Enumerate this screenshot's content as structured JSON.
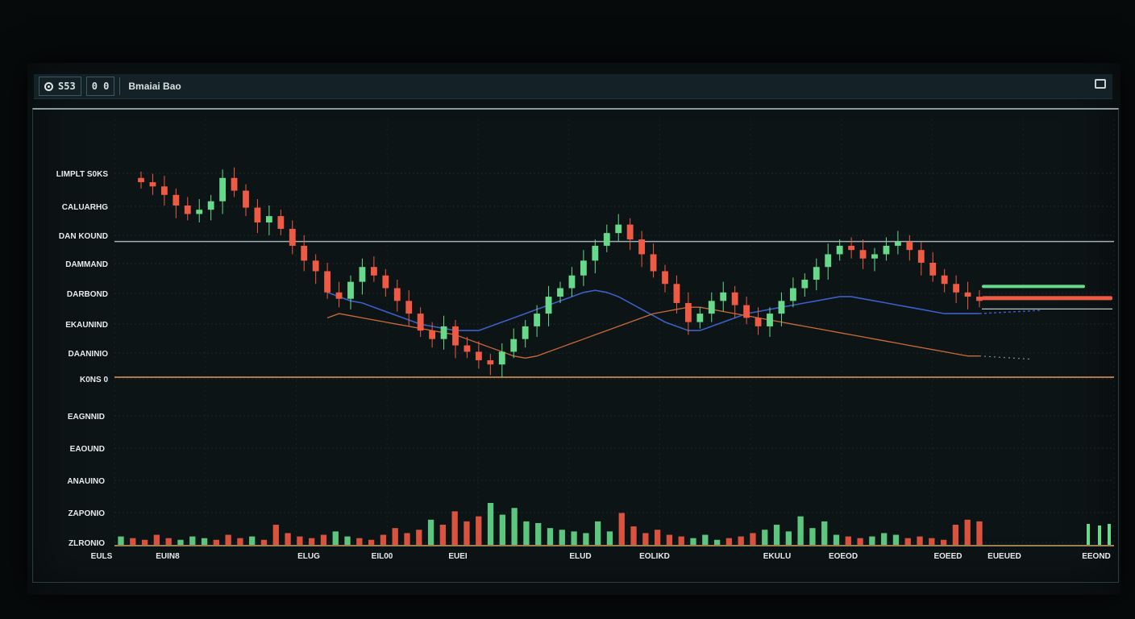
{
  "toolbar": {
    "symbol_box": "S53",
    "interval_box": "0 0",
    "title": "Bmaiai Bao"
  },
  "colors": {
    "up": "#66d98a",
    "down": "#ef5a44",
    "ma_blue": "#3c5fc8",
    "ma_orange": "#c96a3a",
    "support_line": "#e39a5a",
    "resistance_line": "#9fb0b6",
    "background": "#0d1416"
  },
  "chart_data": {
    "type": "candlestick",
    "title": "",
    "price_tick_labels": [
      "LIMPLT S0KS",
      "CALUARHG",
      "DAN KOUND",
      "DAMMAND",
      "DARBOND",
      "EKAUNIND",
      "DAANINIO",
      "K0NS 0"
    ],
    "volume_tick_labels": [
      "EAGNNID",
      "EAOUND",
      "ANAUINO",
      "ZAPONIO",
      "ZLRONIO"
    ],
    "x_tick_labels": [
      "EULS",
      "EUIN8",
      "ELUG",
      "EIL00",
      "EUEI",
      "ELUD",
      "EOLIKD",
      "EKULU",
      "EOEOD",
      "EOEED",
      "EUEUED",
      "EEOND"
    ],
    "price_ylim": [
      0,
      100
    ],
    "horizontal_levels": [
      {
        "name": "resistance",
        "value": 64
      },
      {
        "name": "support",
        "value": 0
      }
    ],
    "price_close": [
      92,
      90,
      86,
      81,
      77,
      79,
      83,
      94,
      88,
      80,
      73,
      76,
      70,
      62,
      55,
      50,
      40,
      37,
      45,
      52,
      48,
      42,
      36,
      30,
      22,
      18,
      24,
      15,
      12,
      8,
      6,
      12,
      18,
      24,
      30,
      38,
      42,
      48,
      55,
      62,
      68,
      72,
      65,
      58,
      50,
      44,
      35,
      26,
      30,
      36,
      40,
      34,
      28,
      24,
      30,
      36,
      42,
      46,
      52,
      58,
      62,
      60,
      56,
      58,
      62,
      64,
      60,
      54,
      48,
      44,
      40,
      38,
      36
    ],
    "volume": [
      5,
      4,
      3,
      6,
      4,
      3,
      5,
      4,
      3,
      6,
      4,
      5,
      3,
      12,
      7,
      5,
      4,
      6,
      8,
      5,
      4,
      3,
      6,
      10,
      7,
      9,
      15,
      12,
      20,
      14,
      17,
      25,
      18,
      22,
      14,
      13,
      10,
      9,
      8,
      7,
      14,
      8,
      19,
      11,
      7,
      9,
      6,
      5,
      4,
      6,
      3,
      4,
      5,
      7,
      9,
      12,
      8,
      17,
      10,
      14,
      6,
      5,
      4,
      5,
      7,
      6,
      4,
      5,
      4,
      3,
      12,
      15,
      14
    ],
    "ma_blue": [
      null,
      null,
      null,
      null,
      null,
      null,
      null,
      null,
      null,
      null,
      null,
      null,
      null,
      null,
      null,
      null,
      40,
      38,
      36,
      35,
      33,
      31,
      29,
      27,
      25,
      24,
      23,
      22,
      22,
      22,
      24,
      26,
      28,
      30,
      32,
      34,
      36,
      38,
      40,
      41,
      40,
      38,
      35,
      32,
      29,
      26,
      24,
      22,
      22,
      24,
      26,
      28,
      30,
      31,
      32,
      33,
      34,
      35,
      36,
      37,
      38,
      38,
      37,
      36,
      35,
      34,
      33,
      32,
      31,
      30,
      30,
      30,
      30
    ],
    "ma_orange": [
      null,
      null,
      null,
      null,
      null,
      null,
      null,
      null,
      null,
      null,
      null,
      null,
      null,
      null,
      null,
      null,
      28,
      30,
      29,
      28,
      27,
      26,
      25,
      24,
      23,
      22,
      21,
      20,
      18,
      16,
      14,
      12,
      10,
      9,
      10,
      12,
      14,
      16,
      18,
      20,
      22,
      24,
      26,
      28,
      30,
      31,
      32,
      33,
      33,
      32,
      31,
      30,
      29,
      28,
      27,
      26,
      25,
      24,
      23,
      22,
      21,
      20,
      19,
      18,
      17,
      16,
      15,
      14,
      13,
      12,
      11,
      10,
      10
    ]
  }
}
